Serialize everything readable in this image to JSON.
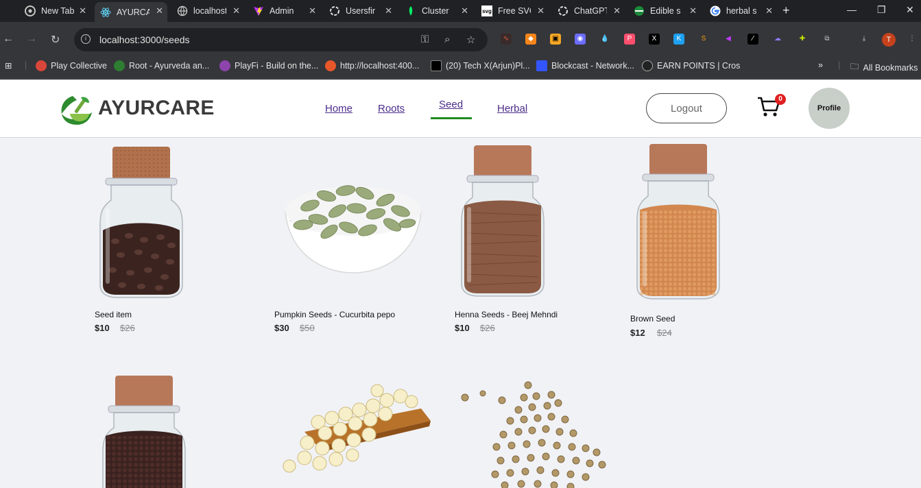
{
  "browser": {
    "tabs": [
      {
        "title": "New Tab",
        "active": false
      },
      {
        "title": "AYURCARE",
        "active": true
      },
      {
        "title": "localhost",
        "active": false
      },
      {
        "title": "Admin",
        "active": false
      },
      {
        "title": "Usersfir",
        "active": false
      },
      {
        "title": "Cluster",
        "active": false
      },
      {
        "title": "Free SVG",
        "active": false
      },
      {
        "title": "ChatGPT",
        "active": false
      },
      {
        "title": "Edible s",
        "active": false
      },
      {
        "title": "herbal s",
        "active": false
      }
    ],
    "url": "localhost:3000/seeds",
    "profile_initial": "T",
    "bookmarks": [
      {
        "label": "Play Collective",
        "color": "#d9473a"
      },
      {
        "label": "Root - Ayurveda an...",
        "color": "#2e7d32"
      },
      {
        "label": "PlayFi - Build on the...",
        "color": "#8e44ad"
      },
      {
        "label": "http://localhost:400...",
        "color": "#e8572a"
      },
      {
        "label": "(20) Tech X(Arjun)Pl...",
        "color": "#000000"
      },
      {
        "label": "Blockcast - Network...",
        "color": "#3355ff"
      },
      {
        "label": "EARN POINTS | Cros",
        "color": "#222222"
      }
    ],
    "all_bookmarks": "All Bookmarks"
  },
  "site": {
    "logo": "AYURCARE",
    "nav": {
      "home": "Home",
      "roots": "Roots",
      "seed": "Seed",
      "herbal": "Herbal"
    },
    "active_nav": "Seed",
    "logout": "Logout",
    "cart_count": "0",
    "profile": "Profile"
  },
  "products": [
    {
      "name": "Seed item",
      "price": "$10",
      "old_price": "$26",
      "image": "jar-dark-seeds"
    },
    {
      "name": "Pumpkin Seeds - Cucurbita pepo",
      "price": "$30",
      "old_price": "$50",
      "image": "bowl-pumpkin-seeds"
    },
    {
      "name": "Henna Seeds - Beej Mehndi",
      "price": "$10",
      "old_price": "$26",
      "image": "jar-brown-seeds"
    },
    {
      "name": "Brown Seed",
      "price": "$12",
      "old_price": "$24",
      "image": "jar-mustard-seeds"
    },
    {
      "name": "",
      "price": "",
      "old_price": "",
      "image": "jar-black-pepper"
    },
    {
      "name": "",
      "price": "",
      "old_price": "",
      "image": "tray-lotus-seeds"
    },
    {
      "name": "",
      "price": "",
      "old_price": "",
      "image": "scattered-coriander-seeds"
    }
  ]
}
